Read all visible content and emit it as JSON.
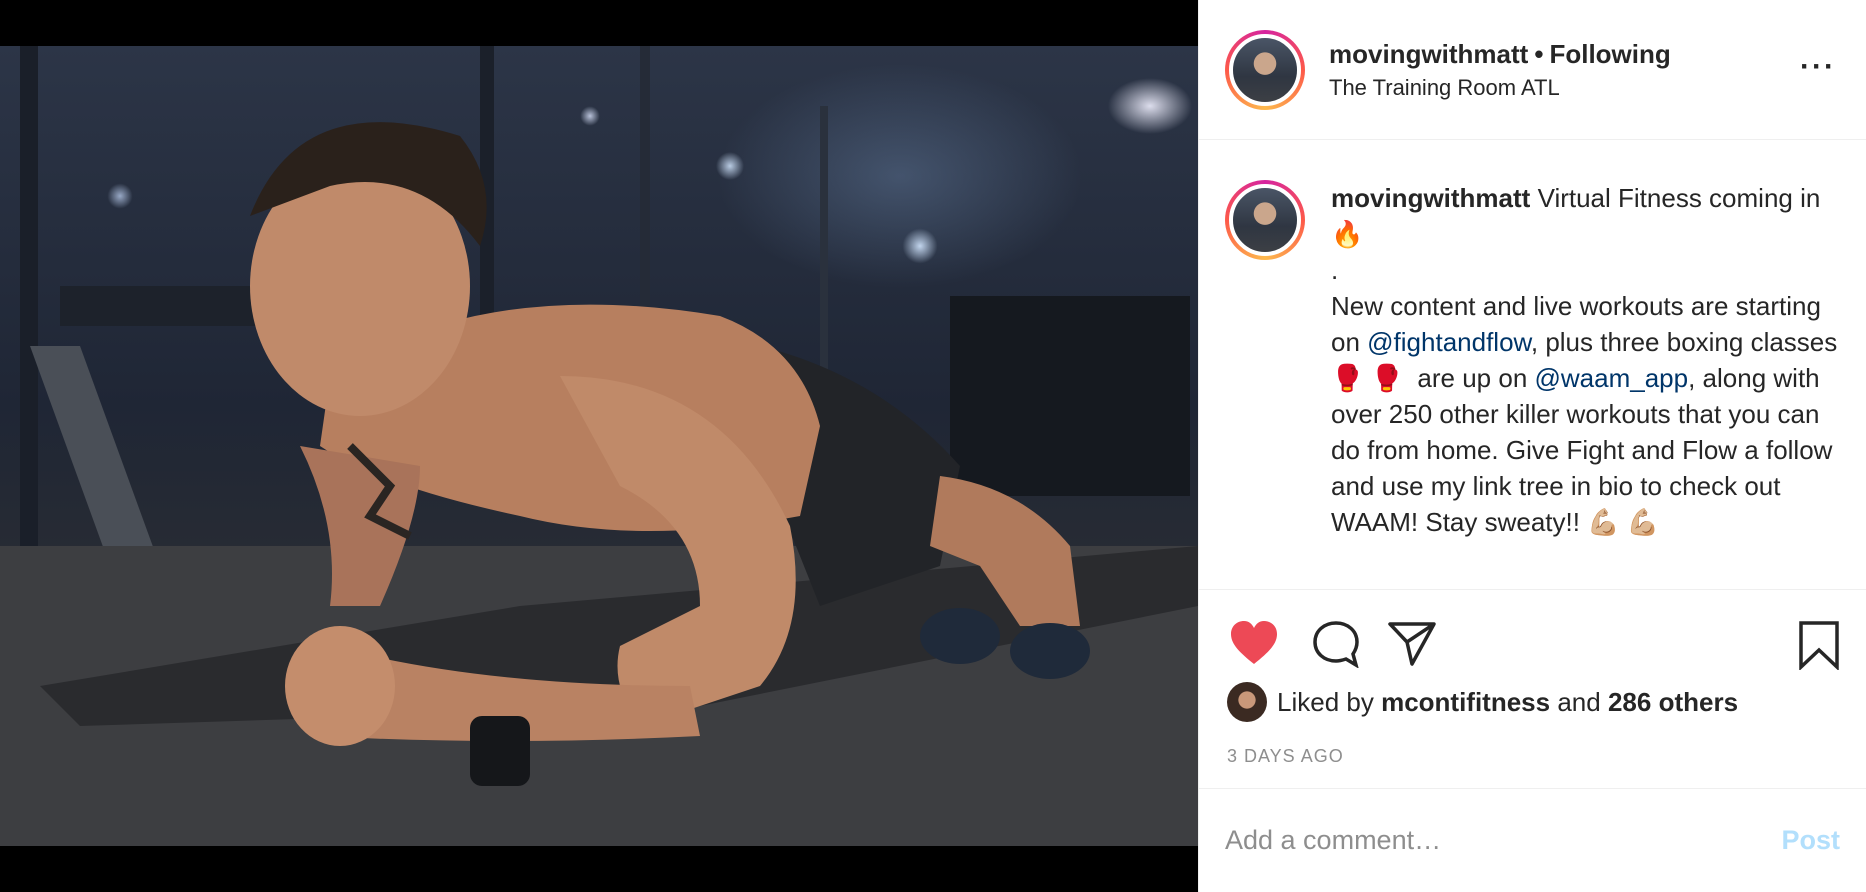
{
  "header": {
    "username": "movingwithmatt",
    "separator": "•",
    "follow_status": "Following",
    "location": "The Training Room ATL",
    "more_icon": "more-horizontal-icon"
  },
  "caption": {
    "username": "movingwithmatt",
    "line1": " Virtual Fitness coming in 🔥",
    "line2": ".",
    "part1": "New content and live workouts are starting on ",
    "mention1": "@fightandflow",
    "part2": ", plus three boxing classes 🥊 🥊  are up on ",
    "mention2": "@waam_app",
    "part3": ", along with over 250 other killer workouts that you can do from home. Give Fight and Flow a follow and use my link tree in bio to check out WAAM! Stay sweaty!! 💪🏼 💪🏼"
  },
  "actions": {
    "like_icon": "heart-filled-icon",
    "comment_icon": "comment-icon",
    "share_icon": "paper-plane-icon",
    "save_icon": "bookmark-icon",
    "like_color": "#ed4956"
  },
  "likes": {
    "prefix": "Liked by ",
    "user": "mcontifitness",
    "middle": " and ",
    "others": "286 others"
  },
  "timestamp": "3 DAYS AGO",
  "comment": {
    "placeholder": "Add a comment…",
    "post_label": "Post"
  }
}
